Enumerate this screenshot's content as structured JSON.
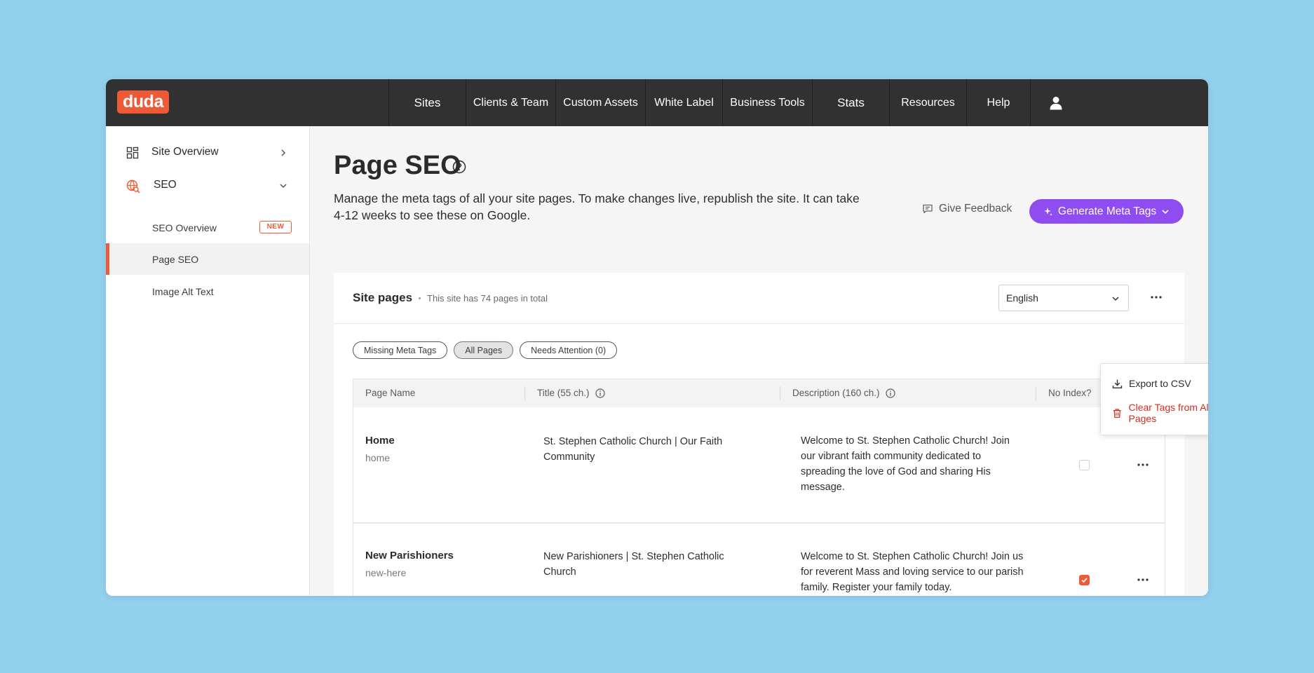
{
  "brand": {
    "logo_text": "duda",
    "accent": "#ee5a35",
    "purple": "#8f4df1"
  },
  "topnav": {
    "items": [
      "Sites",
      "Clients & Team",
      "Custom Assets",
      "White Label",
      "Business Tools",
      "Stats",
      "Resources",
      "Help"
    ],
    "user_icon": "user-icon"
  },
  "sidebar": {
    "site_overview": "Site Overview",
    "seo": "SEO",
    "sub_items": [
      "SEO Overview",
      "Page SEO",
      "Image Alt Text"
    ],
    "new_badge": "NEW"
  },
  "main": {
    "title": "Page SEO",
    "description": "Manage the meta tags of all your site pages. To make changes live, republish the site. It can take 4-12 weeks to see these on Google.",
    "feedback": "Give Feedback",
    "generate": "Generate Meta Tags"
  },
  "card": {
    "title": "Site pages",
    "subtitle": "This site has 74 pages in total",
    "language": "English",
    "filters": [
      "Missing Meta Tags",
      "All Pages",
      "Needs Attention (0)"
    ],
    "active_filter": "All Pages",
    "columns": [
      "Page Name",
      "Title (55 ch.)",
      "Description (160 ch.)",
      "No Index?"
    ],
    "rows": [
      {
        "name": "Home",
        "slug": "home",
        "title": "St. Stephen Catholic Church | Our Faith Community",
        "description": "Welcome to St. Stephen Catholic Church! Join our vibrant faith community dedicated to spreading the love of God and sharing His message.",
        "no_index": false
      },
      {
        "name": "New Parishioners",
        "slug": "new-here",
        "title": "New Parishioners | St. Stephen Catholic Church",
        "description": "Welcome to St. Stephen Catholic Church! Join us for reverent Mass and loving service to our parish family. Register your family today.",
        "no_index": true
      }
    ]
  },
  "dropdown": {
    "export": "Export to CSV",
    "clear": "Clear Tags from All Pages"
  }
}
